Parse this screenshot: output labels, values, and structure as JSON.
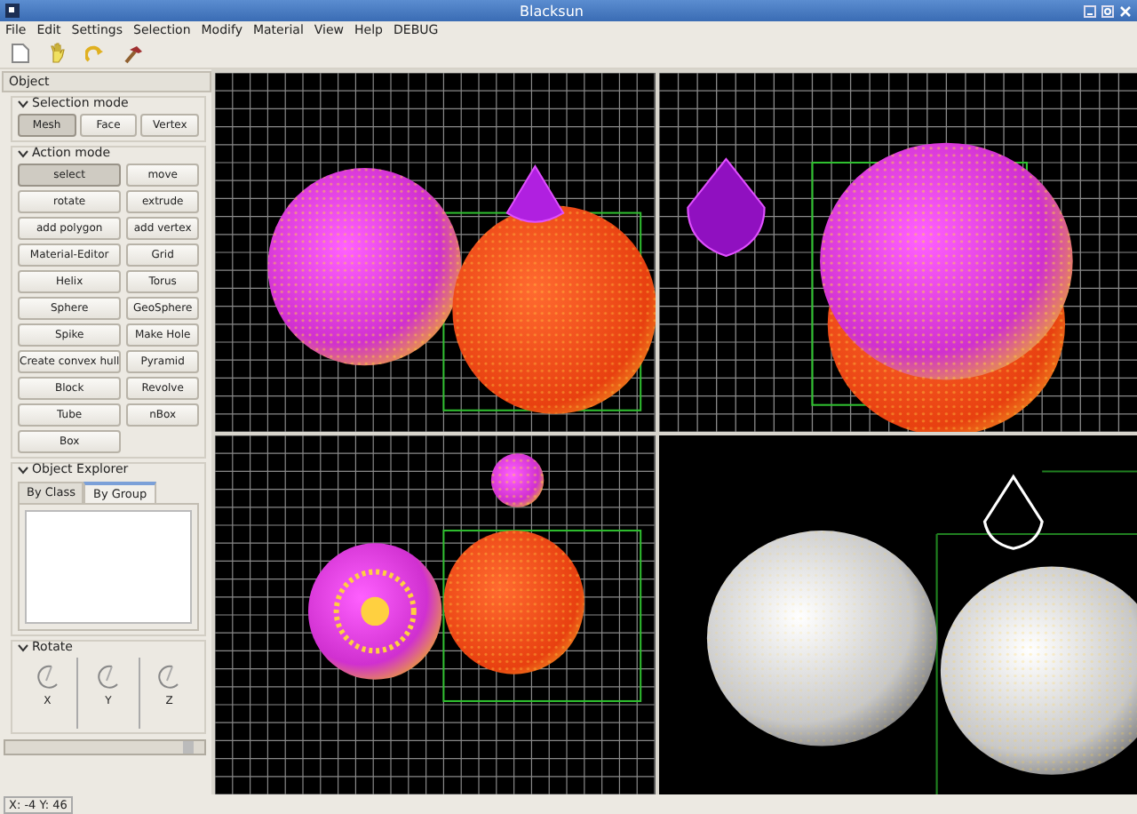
{
  "window": {
    "title": "Blacksun"
  },
  "menu": [
    "File",
    "Edit",
    "Settings",
    "Selection",
    "Modify",
    "Material",
    "View",
    "Help",
    "DEBUG"
  ],
  "panel": {
    "title": "Object",
    "selection_mode": {
      "title": "Selection mode",
      "expanded": true,
      "buttons": [
        {
          "label": "Mesh",
          "selected": true
        },
        {
          "label": "Face",
          "selected": false
        },
        {
          "label": "Vertex",
          "selected": false
        }
      ]
    },
    "action_mode": {
      "title": "Action mode",
      "expanded": true,
      "buttons": [
        {
          "label": "select",
          "selected": true
        },
        {
          "label": "move",
          "selected": false
        },
        {
          "label": "rotate",
          "selected": false
        },
        {
          "label": "extrude",
          "selected": false
        },
        {
          "label": "add polygon",
          "selected": false
        },
        {
          "label": "add vertex",
          "selected": false
        },
        {
          "label": "Material-Editor",
          "selected": false
        },
        {
          "label": "Grid",
          "selected": false
        },
        {
          "label": "Helix",
          "selected": false
        },
        {
          "label": "Torus",
          "selected": false
        },
        {
          "label": "Sphere",
          "selected": false
        },
        {
          "label": "GeoSphere",
          "selected": false
        },
        {
          "label": "Spike",
          "selected": false
        },
        {
          "label": "Make Hole",
          "selected": false
        },
        {
          "label": "Create convex hull",
          "selected": false
        },
        {
          "label": "Pyramid",
          "selected": false
        },
        {
          "label": "Block",
          "selected": false
        },
        {
          "label": "Revolve",
          "selected": false
        },
        {
          "label": "Tube",
          "selected": false
        },
        {
          "label": "nBox",
          "selected": false
        },
        {
          "label": "Box",
          "selected": false
        }
      ]
    },
    "object_explorer": {
      "title": "Object Explorer",
      "expanded": true,
      "tabs": [
        {
          "label": "By Class",
          "selected": false
        },
        {
          "label": "By Group",
          "selected": true
        }
      ]
    },
    "rotate": {
      "title": "Rotate",
      "expanded": true,
      "dials": [
        "X",
        "Y",
        "Z"
      ]
    }
  },
  "viewports": [
    {
      "kind": "grid"
    },
    {
      "kind": "grid"
    },
    {
      "kind": "grid"
    },
    {
      "kind": "render"
    }
  ],
  "status_bar": {
    "text": "X: -4 Y: 46"
  }
}
